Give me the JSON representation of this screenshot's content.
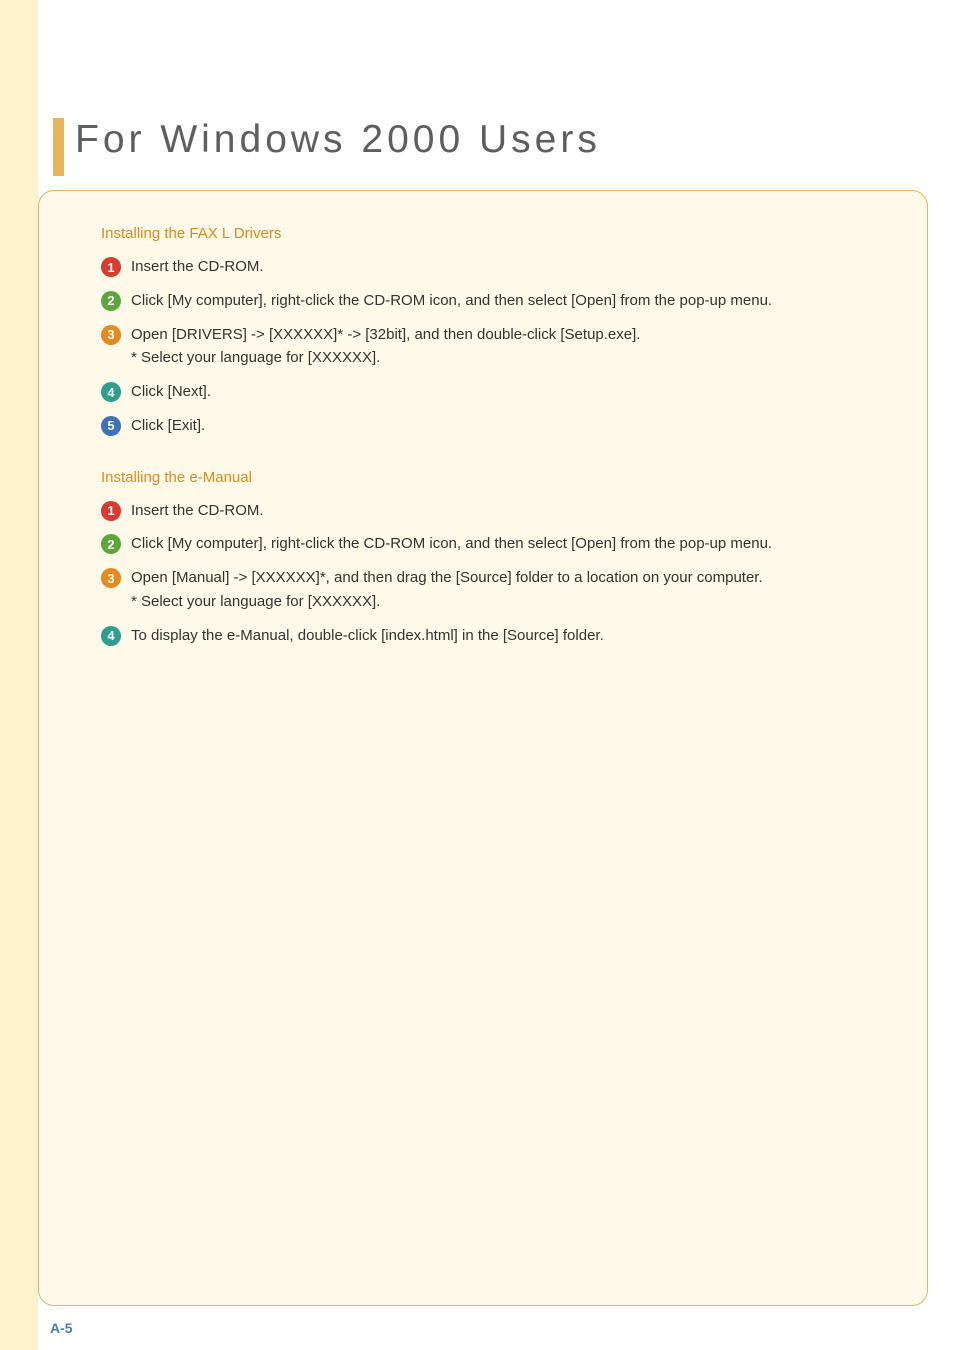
{
  "heading": "For Windows 2000 Users",
  "sections": [
    {
      "title": "Installing the FAX L Drivers",
      "steps": [
        {
          "num": "1",
          "colorClass": "c-red",
          "text": "Insert the CD-ROM."
        },
        {
          "num": "2",
          "colorClass": "c-green",
          "text": "Click [My computer], right-click the CD-ROM icon, and then select [Open] from the pop-up menu."
        },
        {
          "num": "3",
          "colorClass": "c-orange",
          "text": "Open [DRIVERS] -> [XXXXXX]* -> [32bit], and then double-click [Setup.exe].",
          "sub": "* Select your language for [XXXXXX]."
        },
        {
          "num": "4",
          "colorClass": "c-teal",
          "text": "Click [Next]."
        },
        {
          "num": "5",
          "colorClass": "c-blue",
          "text": "Click [Exit]."
        }
      ]
    },
    {
      "title": "Installing the e-Manual",
      "steps": [
        {
          "num": "1",
          "colorClass": "c-red",
          "text": "Insert the CD-ROM."
        },
        {
          "num": "2",
          "colorClass": "c-green",
          "text": "Click [My computer], right-click the CD-ROM icon, and then select [Open] from the pop-up menu."
        },
        {
          "num": "3",
          "colorClass": "c-orange",
          "text": "Open [Manual] -> [XXXXXX]*, and then drag the [Source] folder to a location on your computer.",
          "sub": "* Select your language for [XXXXXX]."
        },
        {
          "num": "4",
          "colorClass": "c-teal",
          "text": "To display the e-Manual, double-click [index.html] in the [Source] folder."
        }
      ]
    }
  ],
  "pageNumber": "A-5"
}
